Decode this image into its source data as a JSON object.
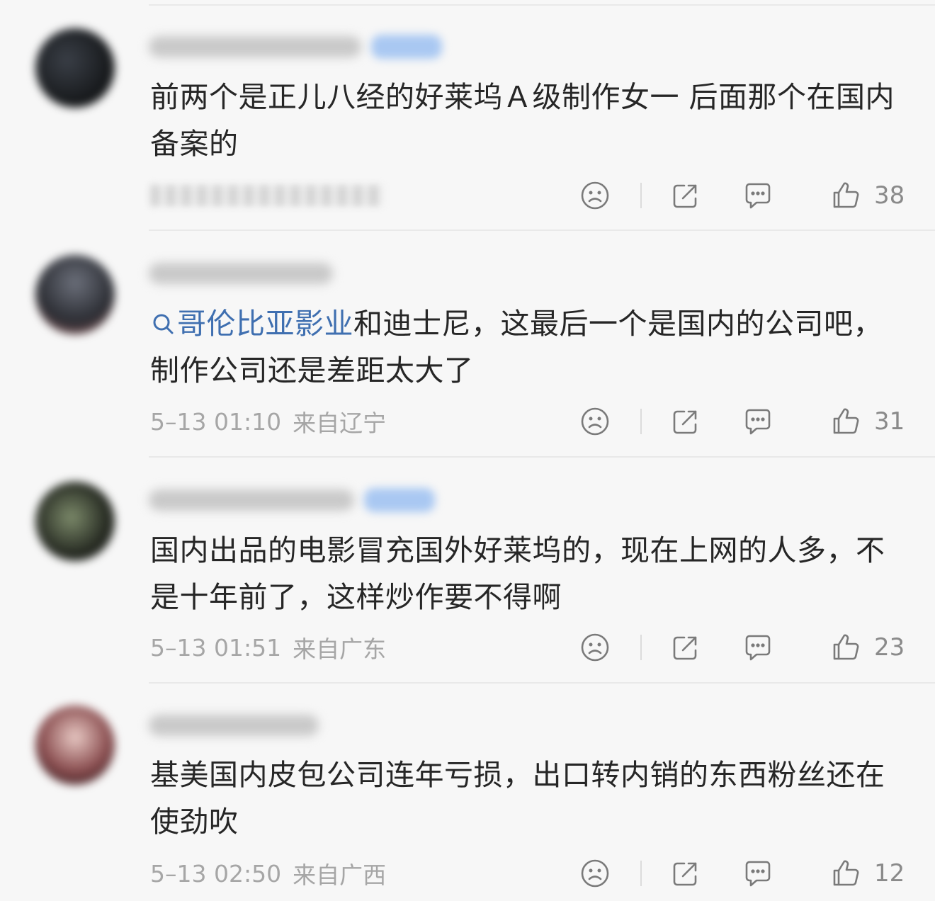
{
  "comments": [
    {
      "body_parts": [
        "前两个是正儿八经的好莱坞Ａ级制作女一  后面那个在国内备案的"
      ],
      "topic": "",
      "time": "",
      "location": "",
      "likes": "38"
    },
    {
      "topic": "哥伦比亚影业",
      "body": "和迪士尼，这最后一个是国内的公司吧，制作公司还是差距太大了",
      "time": "5–13 01:10",
      "location": "来自辽宁",
      "likes": "31"
    },
    {
      "topic": "",
      "body": "国内出品的电影冒充国外好莱坞的，现在上网的人多，不是十年前了，这样炒作要不得啊",
      "time": "5–13 01:51",
      "location": "来自广东",
      "likes": "23"
    },
    {
      "topic": "",
      "body": "基美国内皮包公司连年亏损，出口转内销的东西粉丝还在使劲吹",
      "time": "5–13 02:50",
      "location": "来自广西",
      "likes": "12"
    }
  ],
  "icons": {
    "dislike": "frown-face-icon",
    "share": "share-icon",
    "reply": "comment-bubble-icon",
    "like": "thumbs-up-icon"
  },
  "colors": {
    "text": "#262626",
    "meta": "#a6a6a6",
    "topic": "#3f6fb0",
    "icon": "#7a7a7a",
    "divider": "#e9e9e9"
  }
}
